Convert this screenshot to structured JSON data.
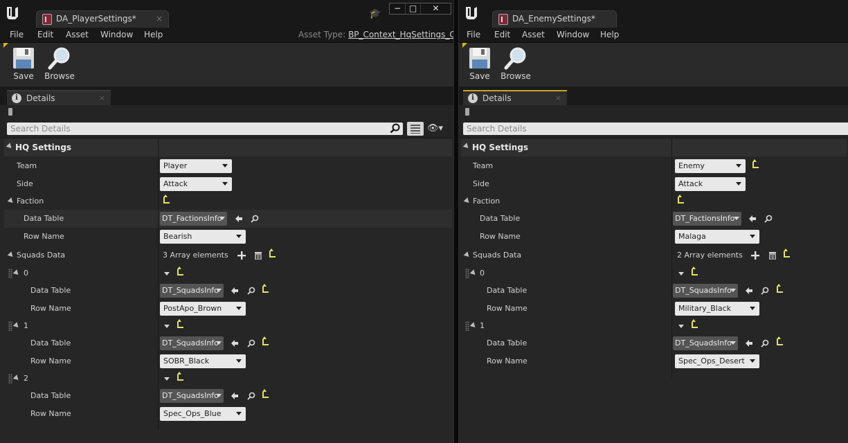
{
  "left_window": {
    "tab_title": "DA_PlayerSettings*",
    "menu": [
      "File",
      "Edit",
      "Asset",
      "Window",
      "Help"
    ],
    "asset_type_label": "Asset Type:",
    "asset_type_value": "BP_Context_HqSettings_C",
    "toolbar": {
      "save_label": "Save",
      "browse_label": "Browse"
    },
    "panel_tab": "Details",
    "search_placeholder": "Search Details",
    "category": "HQ Settings",
    "team_label": "Team",
    "team_value": "Player",
    "side_label": "Side",
    "side_value": "Attack",
    "faction_label": "Faction",
    "faction_datatable_label": "Data Table",
    "faction_datatable_value": "DT_FactionsInfo",
    "faction_rowname_label": "Row Name",
    "faction_rowname_value": "Bearish",
    "squads_label": "Squads Data",
    "squads_count": "3 Array elements",
    "squads": [
      {
        "index": "0",
        "datatable_label": "Data Table",
        "datatable_value": "DT_SquadsInfo",
        "rowname_label": "Row Name",
        "rowname_value": "PostApo_Brown"
      },
      {
        "index": "1",
        "datatable_label": "Data Table",
        "datatable_value": "DT_SquadsInfo",
        "rowname_label": "Row Name",
        "rowname_value": "SOBR_Black"
      },
      {
        "index": "2",
        "datatable_label": "Data Table",
        "datatable_value": "DT_SquadsInfo",
        "rowname_label": "Row Name",
        "rowname_value": "Spec_Ops_Blue"
      }
    ]
  },
  "right_window": {
    "tab_title": "DA_EnemySettings*",
    "menu": [
      "File",
      "Edit",
      "Asset",
      "Window",
      "Help"
    ],
    "toolbar": {
      "save_label": "Save",
      "browse_label": "Browse"
    },
    "panel_tab": "Details",
    "search_placeholder": "Search Details",
    "category": "HQ Settings",
    "team_label": "Team",
    "team_value": "Enemy",
    "side_label": "Side",
    "side_value": "Attack",
    "faction_label": "Faction",
    "faction_datatable_label": "Data Table",
    "faction_datatable_value": "DT_FactionsInfo",
    "faction_rowname_label": "Row Name",
    "faction_rowname_value": "Malaga",
    "squads_label": "Squads Data",
    "squads_count": "2 Array elements",
    "squads": [
      {
        "index": "0",
        "datatable_label": "Data Table",
        "datatable_value": "DT_SquadsInfo",
        "rowname_label": "Row Name",
        "rowname_value": "Military_Black"
      },
      {
        "index": "1",
        "datatable_label": "Data Table",
        "datatable_value": "DT_SquadsInfo",
        "rowname_label": "Row Name",
        "rowname_value": "Spec_Ops_Desert"
      }
    ]
  },
  "colors": {
    "reset_arrow": "#e5e35d",
    "active_tab_accent": "#c7a622",
    "panel_bg": "#262626"
  }
}
